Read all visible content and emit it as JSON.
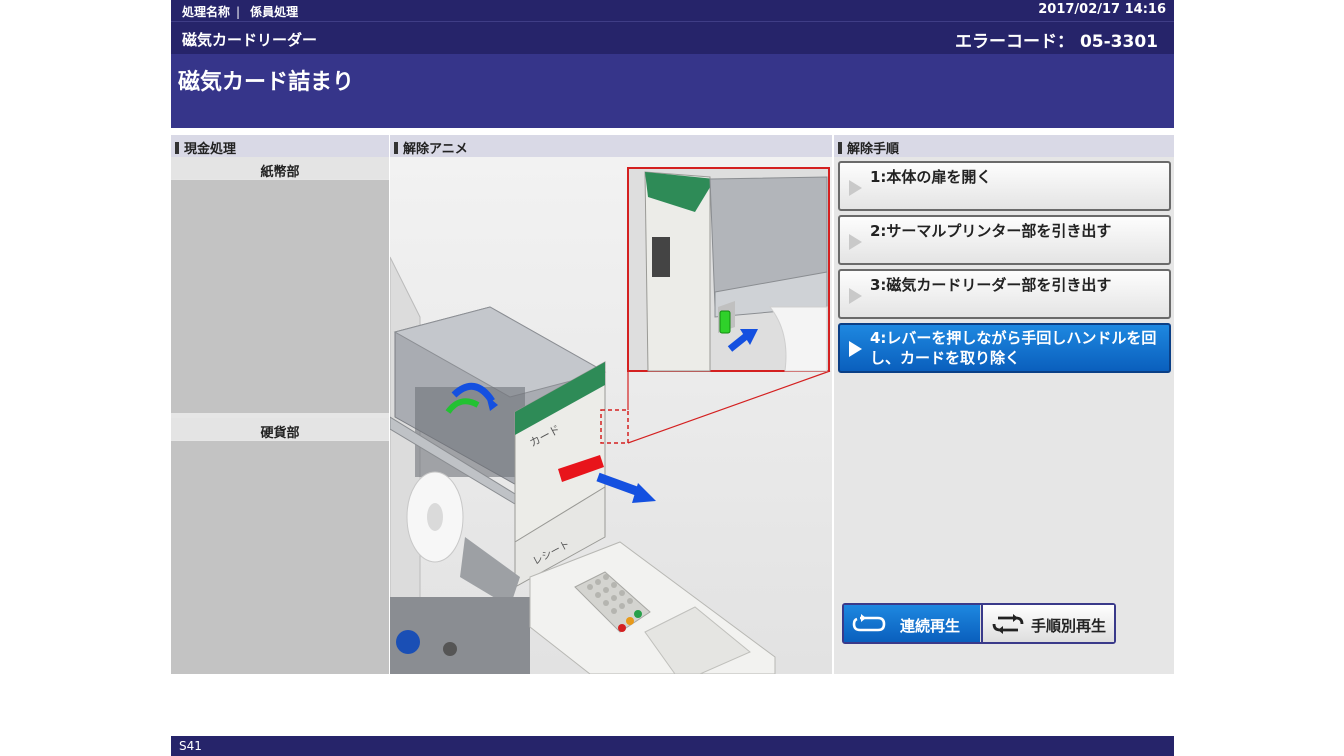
{
  "header": {
    "process_name_label": "処理名称",
    "process_name": "係員処理",
    "datetime": "2017/02/17 14:16",
    "device_name": "磁気カードリーダー",
    "error_code_label": "エラーコード：",
    "error_code": "05-3301",
    "error_title": "磁気カード詰まり"
  },
  "sections": {
    "cash": "現金処理",
    "animation": "解除アニメ",
    "procedure": "解除手順"
  },
  "cash_panel": {
    "bill_label": "紙幣部",
    "coin_label": "硬貨部"
  },
  "animation": {
    "card_text": "カード",
    "receipt_text": "レシート"
  },
  "steps": [
    {
      "label": "1:本体の扉を開く",
      "active": false
    },
    {
      "label": "2:サーマルプリンター部を引き出す",
      "active": false
    },
    {
      "label": "3:磁気カードリーダー部を引き出す",
      "active": false
    },
    {
      "label": "4:レバーを押しながら手回しハンドルを回し、カードを取り除く",
      "active": true
    }
  ],
  "playback": {
    "continuous": "連続再生",
    "stepwise": "手順別再生",
    "continuous_icon": "loop-icon",
    "stepwise_icon": "repeat-icon"
  },
  "footer": {
    "screen_id": "S41"
  },
  "colors": {
    "header_bg": "#26246a",
    "title_bg": "#36358a",
    "active_step": "#0a6fd0",
    "card_red": "#e8141b",
    "arrow_blue": "#1450e0",
    "panel_green": "#2e8b57"
  }
}
